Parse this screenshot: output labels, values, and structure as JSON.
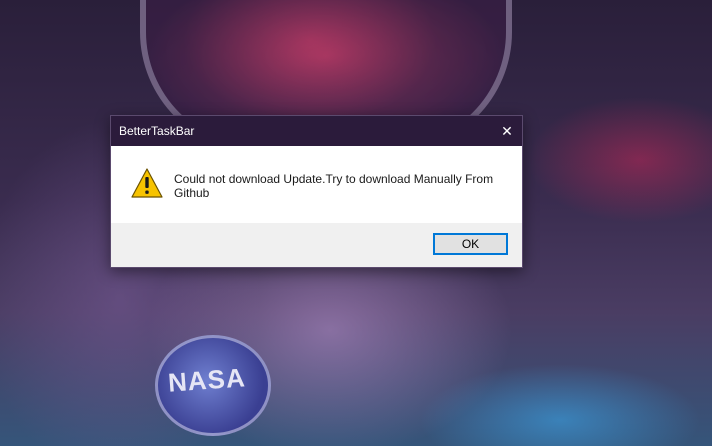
{
  "dialog": {
    "title": "BetterTaskBar",
    "message": "Could not download Update.Try to download Manually From Github",
    "icon": "warning-icon",
    "ok_label": "OK",
    "close_glyph": "✕"
  },
  "wallpaper": {
    "patch_text": "NASA"
  },
  "colors": {
    "titlebar": "#2b1b3b",
    "button_border": "#0078d7",
    "footer": "#f0f0f0"
  }
}
